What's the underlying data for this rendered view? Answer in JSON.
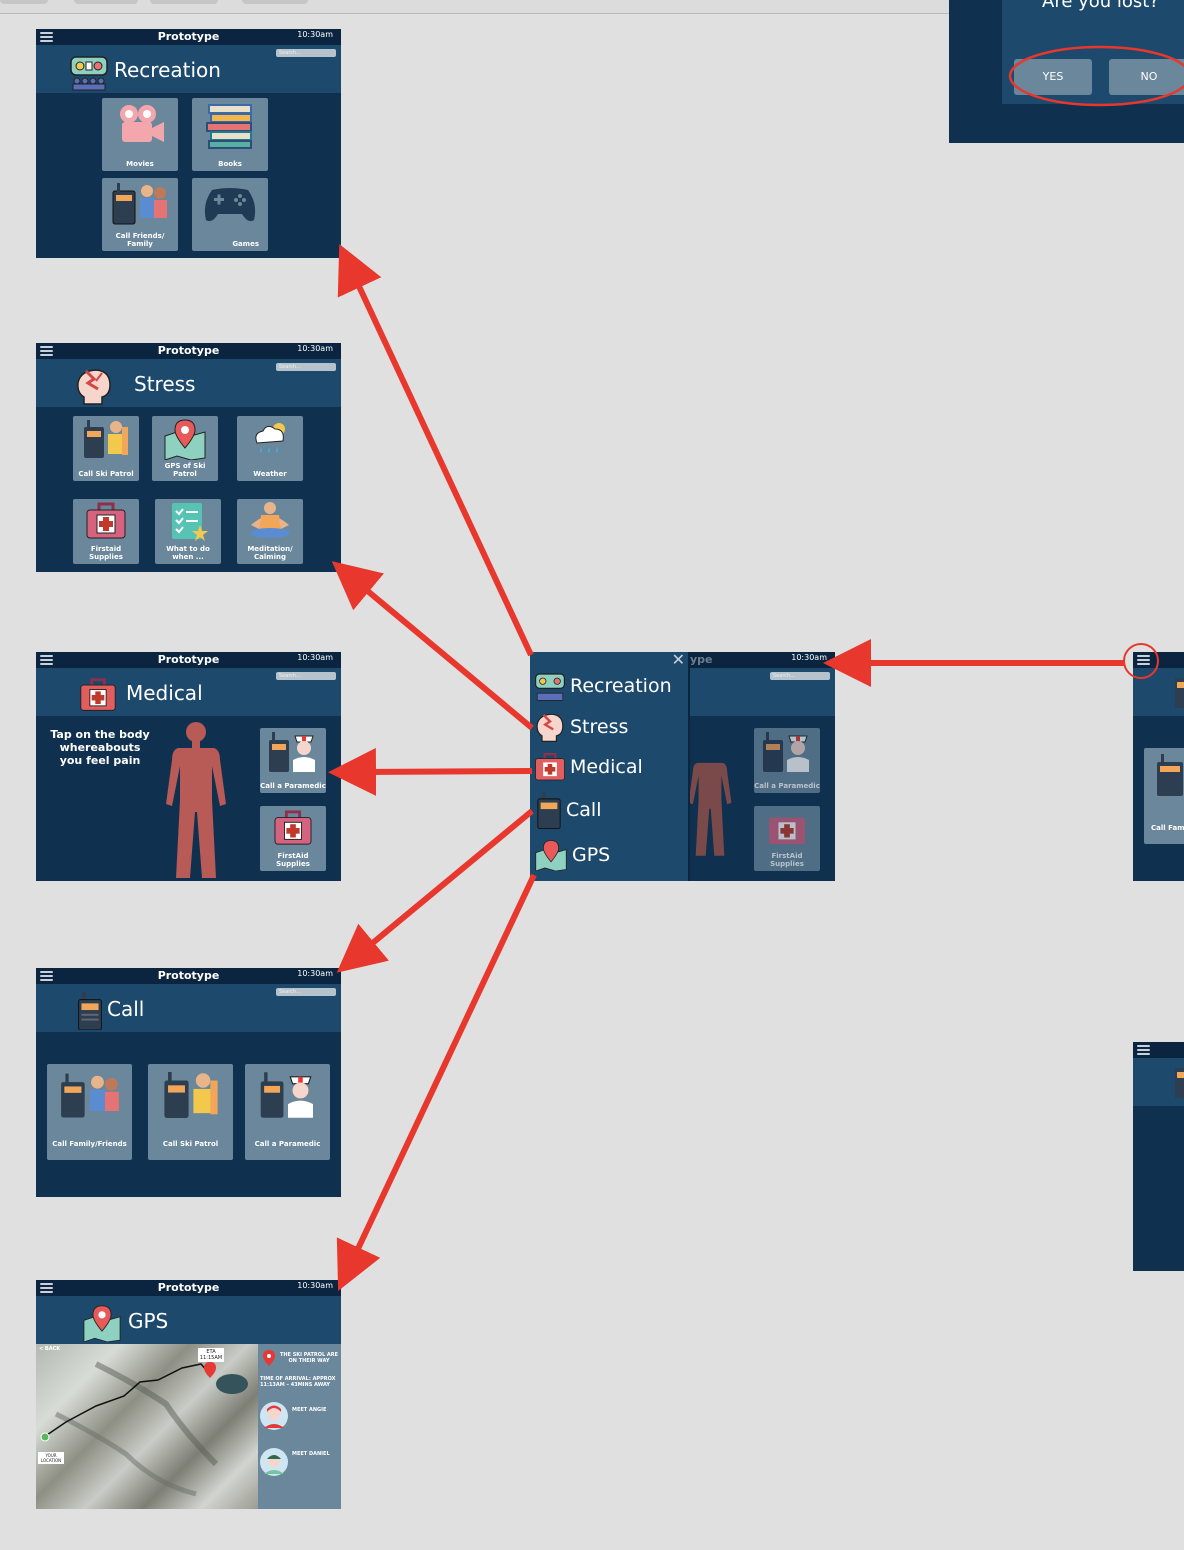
{
  "app": {
    "frame_title": "Prototype",
    "time": "10:30am",
    "search_placeholder": "Search..."
  },
  "dialog": {
    "question": "Are you lost?",
    "yes": "YES",
    "no": "NO"
  },
  "recreation": {
    "label": "Recreation",
    "tiles": [
      "Movies",
      "Books",
      "Call Friends/ Family",
      "Games"
    ]
  },
  "stress": {
    "label": "Stress",
    "tiles": [
      "Call Ski Patrol",
      "GPS of Ski Patrol",
      "Weather",
      "Firstaid Supplies",
      "What to do when ...",
      "Meditation/ Calming"
    ]
  },
  "medical": {
    "label": "Medical",
    "prompt": "Tap on the body whereabouts you feel pain",
    "tiles": [
      "Call a Paramedic",
      "FirstAid Supplies"
    ]
  },
  "call": {
    "label": "Call",
    "tiles": [
      "Call Family/Friends",
      "Call Ski Patrol",
      "Call a Paramedic"
    ]
  },
  "gps": {
    "label": "GPS",
    "back": "< BACK",
    "eta": "ETA 11:15AM",
    "your_location": "YOUR LOCATION",
    "status": "THE SKI PATROL ARE ON THEIR WAY",
    "arrival": "TIME OF ARRIVAL: APPROX 11:13AM – 43MINS AWAY",
    "meet1": "MEET ANGIE",
    "meet2": "MEET DANIEL"
  },
  "menu_overlay": {
    "items": [
      "Recreation",
      "Stress",
      "Medical",
      "Call",
      "GPS"
    ],
    "behind_title": "ype",
    "behind_tiles": [
      "Call a Paramedic",
      "FirstAid Supplies"
    ]
  },
  "right_partial": {
    "tile1": "Call Fami"
  },
  "colors": {
    "arrow": "#e8372c",
    "frame_bg": "#10304f",
    "header_band": "#1d4a6c",
    "tile": "#6b879b"
  }
}
